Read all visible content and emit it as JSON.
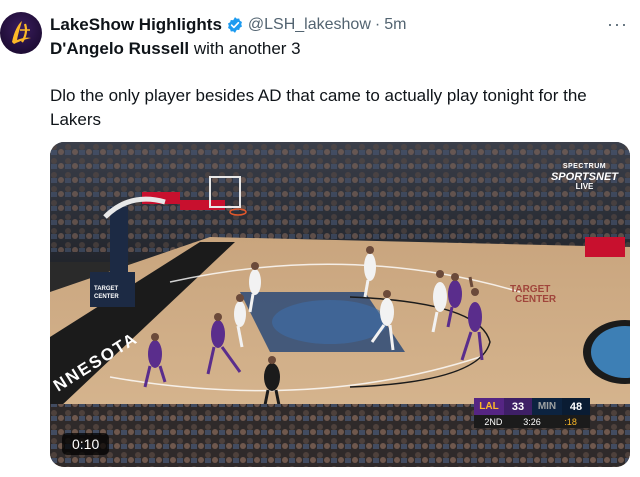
{
  "tweet": {
    "display_name": "LakeShow Highlights",
    "handle": "@LSH_lakeshow",
    "separator": "·",
    "time": "5m",
    "more_label": "···",
    "subject_name": "D'Angelo Russell",
    "subject_rest": " with another 3",
    "body": "Dlo the only player besides AD that came to actually play tonight for the Lakers"
  },
  "video": {
    "duration": "0:10",
    "network": {
      "line1": "SPECTRUM",
      "line2": "SPORTSNET",
      "line3": "LIVE"
    },
    "court_texts": {
      "baseline": "NNESOTA",
      "sponsor": "TARGET CENTER",
      "sponsor_left": "TARGET CENTER",
      "target": "TARGET",
      "center": "CENTER"
    },
    "scorebug": {
      "away_team": "LAL",
      "away_score": "33",
      "home_team": "MIN",
      "home_score": "48",
      "quarter": "2ND",
      "clock": "3:26",
      "shot_clock": ":18"
    }
  },
  "colors": {
    "verified": "#1d9bf0",
    "lakers_purple": "#552583",
    "lakers_gold": "#fdb927",
    "wolves_navy": "#0c2340",
    "secondary_text": "#536471"
  }
}
